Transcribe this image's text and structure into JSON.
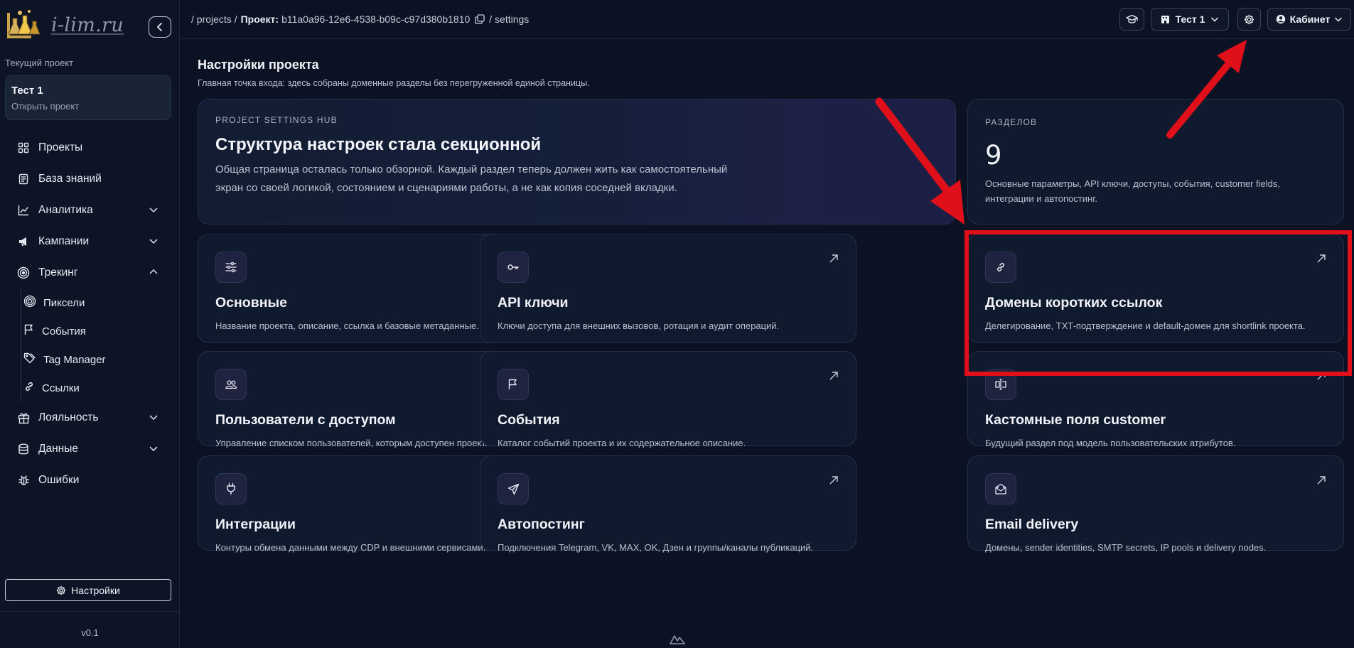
{
  "logo": {
    "text": "i-lim.ru"
  },
  "sidebar": {
    "current_project_label": "Текущий проект",
    "project_card": {
      "name": "Тест 1",
      "link": "Открыть проект"
    },
    "items": [
      {
        "label": "Проекты",
        "icon": "grid-icon"
      },
      {
        "label": "База знаний",
        "icon": "book-icon"
      },
      {
        "label": "Аналитика",
        "icon": "chart-icon",
        "expandable": true,
        "expanded": false
      },
      {
        "label": "Кампании",
        "icon": "megaphone-icon",
        "expandable": true,
        "expanded": false
      },
      {
        "label": "Трекинг",
        "icon": "target-icon",
        "expandable": true,
        "expanded": true
      },
      {
        "label": "Лояльность",
        "icon": "gift-icon",
        "expandable": true,
        "expanded": false
      },
      {
        "label": "Данные",
        "icon": "database-icon",
        "expandable": true,
        "expanded": false
      },
      {
        "label": "Ошибки",
        "icon": "bug-icon"
      }
    ],
    "tracking_sub": [
      {
        "label": "Пиксели",
        "icon": "pixel-icon"
      },
      {
        "label": "События",
        "icon": "flag-icon"
      },
      {
        "label": "Tag Manager",
        "icon": "tag-icon"
      },
      {
        "label": "Ссылки",
        "icon": "link-icon"
      }
    ],
    "settings_button": "Настройки",
    "version": "v0.1"
  },
  "topbar": {
    "crumb_projects": "/ projects /",
    "crumb_project_label": "Проект:",
    "crumb_project_id": "b11a0a96-12e6-4538-b09c-c97d380b1810",
    "crumb_settings": "/ settings",
    "project_select": "Тест 1",
    "cabinet": "Кабинет"
  },
  "page": {
    "title": "Настройки проекта",
    "subtitle": "Главная точка входа: здесь собраны доменные разделы без перегруженной единой страницы."
  },
  "hero": {
    "eyebrow": "PROJECT SETTINGS HUB",
    "title": "Структура настроек стала секционной",
    "text": "Общая страница осталась только обзорной. Каждый раздел теперь должен жить как самостоятельный экран со своей логикой, состоянием и сценариями работы, а не как копия соседней вкладки."
  },
  "stat": {
    "label": "РАЗДЕЛОВ",
    "value": "9",
    "text": "Основные параметры, API ключи, доступы, события, customer fields, интеграции и автопостинг."
  },
  "tiles": [
    {
      "title": "Основные",
      "desc": "Название проекта, описание, ссылка и базовые метаданные.",
      "icon": "sliders-icon"
    },
    {
      "title": "API ключи",
      "desc": "Ключи доступа для внешних вызовов, ротация и аудит операций.",
      "icon": "key-icon"
    },
    {
      "title": "Домены коротких ссылок",
      "desc": "Делегирование, TXT-подтверждение и default-домен для shortlink проекта.",
      "icon": "link-icon"
    },
    {
      "title": "Пользователи с доступом",
      "desc": "Управление списком пользователей, которым доступен проект.",
      "icon": "users-icon"
    },
    {
      "title": "События",
      "desc": "Каталог событий проекта и их содержательное описание.",
      "icon": "flag-icon"
    },
    {
      "title": "Кастомные поля customer",
      "desc": "Будущий раздел под модель пользовательских атрибутов.",
      "icon": "fields-icon"
    },
    {
      "title": "Интеграции",
      "desc": "Контуры обмена данными между CDP и внешними сервисами.",
      "icon": "plug-icon"
    },
    {
      "title": "Автопостинг",
      "desc": "Подключения Telegram, VK, MAX, OK, Дзен и группы/каналы публикаций.",
      "icon": "send-icon"
    },
    {
      "title": "Email delivery",
      "desc": "Домены, sender identities, SMTP secrets, IP pools и delivery nodes.",
      "icon": "mail-icon"
    }
  ],
  "colors": {
    "background": "#0b1224",
    "card": "#101a2e",
    "annotation_red": "#e0101a"
  }
}
